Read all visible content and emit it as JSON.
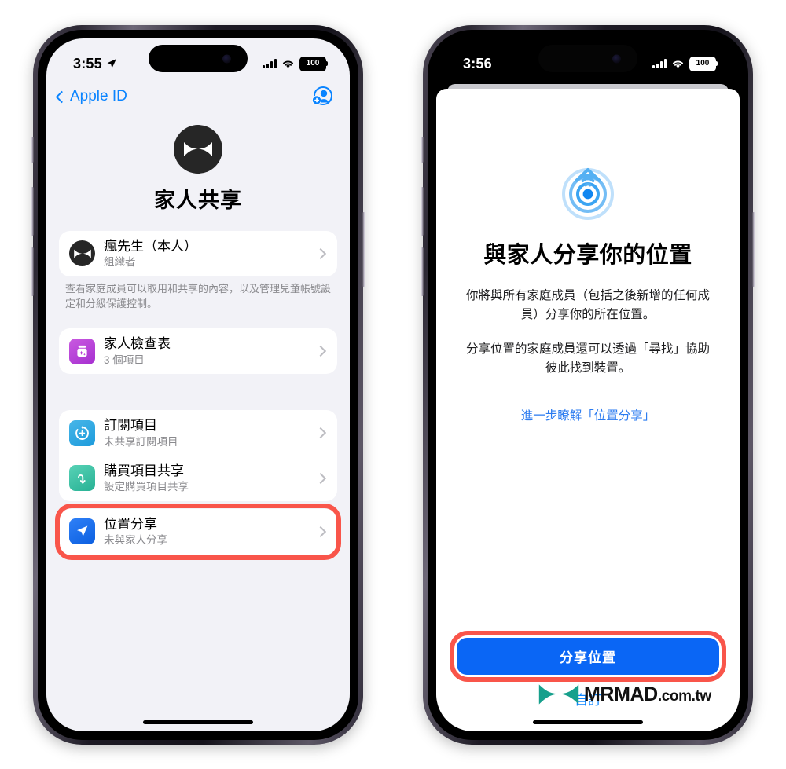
{
  "page": {
    "background": "#ffffff",
    "accent_blue": "#0a84ff",
    "highlight_red": "#f9554a"
  },
  "left_phone": {
    "status": {
      "time": "3:55",
      "location_arrow_icon": "location-arrow-icon",
      "signal_icon": "cellular-bars-icon",
      "wifi_icon": "wifi-icon",
      "battery_level": "100"
    },
    "nav": {
      "back_label": "Apple ID",
      "back_icon": "chevron-left-icon",
      "add_member_icon": "add-person-icon"
    },
    "hero": {
      "avatar_icon": "mrmad-bowtie-avatar",
      "title": "家人共享"
    },
    "member_row": {
      "icon": "mrmad-bowtie-avatar",
      "title": "瘋先生（本人）",
      "subtitle": "組織者",
      "chevron": "chevron-right-icon"
    },
    "member_footnote": "查看家庭成員可以取用和共享的內容，以及管理兒童帳號設定和分級保護控制。",
    "checklist_row": {
      "icon": "family-checklist-icon",
      "icon_color": "#b93bd6",
      "title": "家人檢查表",
      "subtitle": "3 個項目",
      "chevron": "chevron-right-icon"
    },
    "rows": [
      {
        "icon": "subscriptions-icon",
        "icon_color": "#34aadc",
        "title": "訂閱項目",
        "subtitle": "未共享訂閱項目",
        "chevron": "chevron-right-icon"
      },
      {
        "icon": "purchase-sharing-icon",
        "icon_color": "#3bc1a8",
        "title": "購買項目共享",
        "subtitle": "設定購買項目共享",
        "chevron": "chevron-right-icon"
      },
      {
        "icon": "location-sharing-icon",
        "icon_color": "#1a6ef0",
        "title": "位置分享",
        "subtitle": "未與家人分享",
        "chevron": "chevron-right-icon",
        "highlighted": true
      }
    ]
  },
  "right_phone": {
    "status": {
      "time": "3:56",
      "signal_icon": "cellular-bars-icon",
      "wifi_icon": "wifi-icon",
      "battery_level": "100"
    },
    "sheet": {
      "icon": "find-my-radar-icon",
      "title": "與家人分享你的位置",
      "paragraph_1": "你將與所有家庭成員（包括之後新增的任何成員）分享你的所在位置。",
      "paragraph_2": "分享位置的家庭成員還可以透過「尋找」協助彼此找到裝置。",
      "learn_more_link": "進一步瞭解「位置分享」",
      "primary_button": "分享位置",
      "primary_button_color": "#0a66f5",
      "secondary_button": "自訂",
      "primary_highlighted": true
    }
  },
  "watermark": {
    "logo_icon": "mrmad-bowtie-logo",
    "logo_color": "#17a08c",
    "brand": "MRMAD",
    "tld": ".com.tw"
  }
}
